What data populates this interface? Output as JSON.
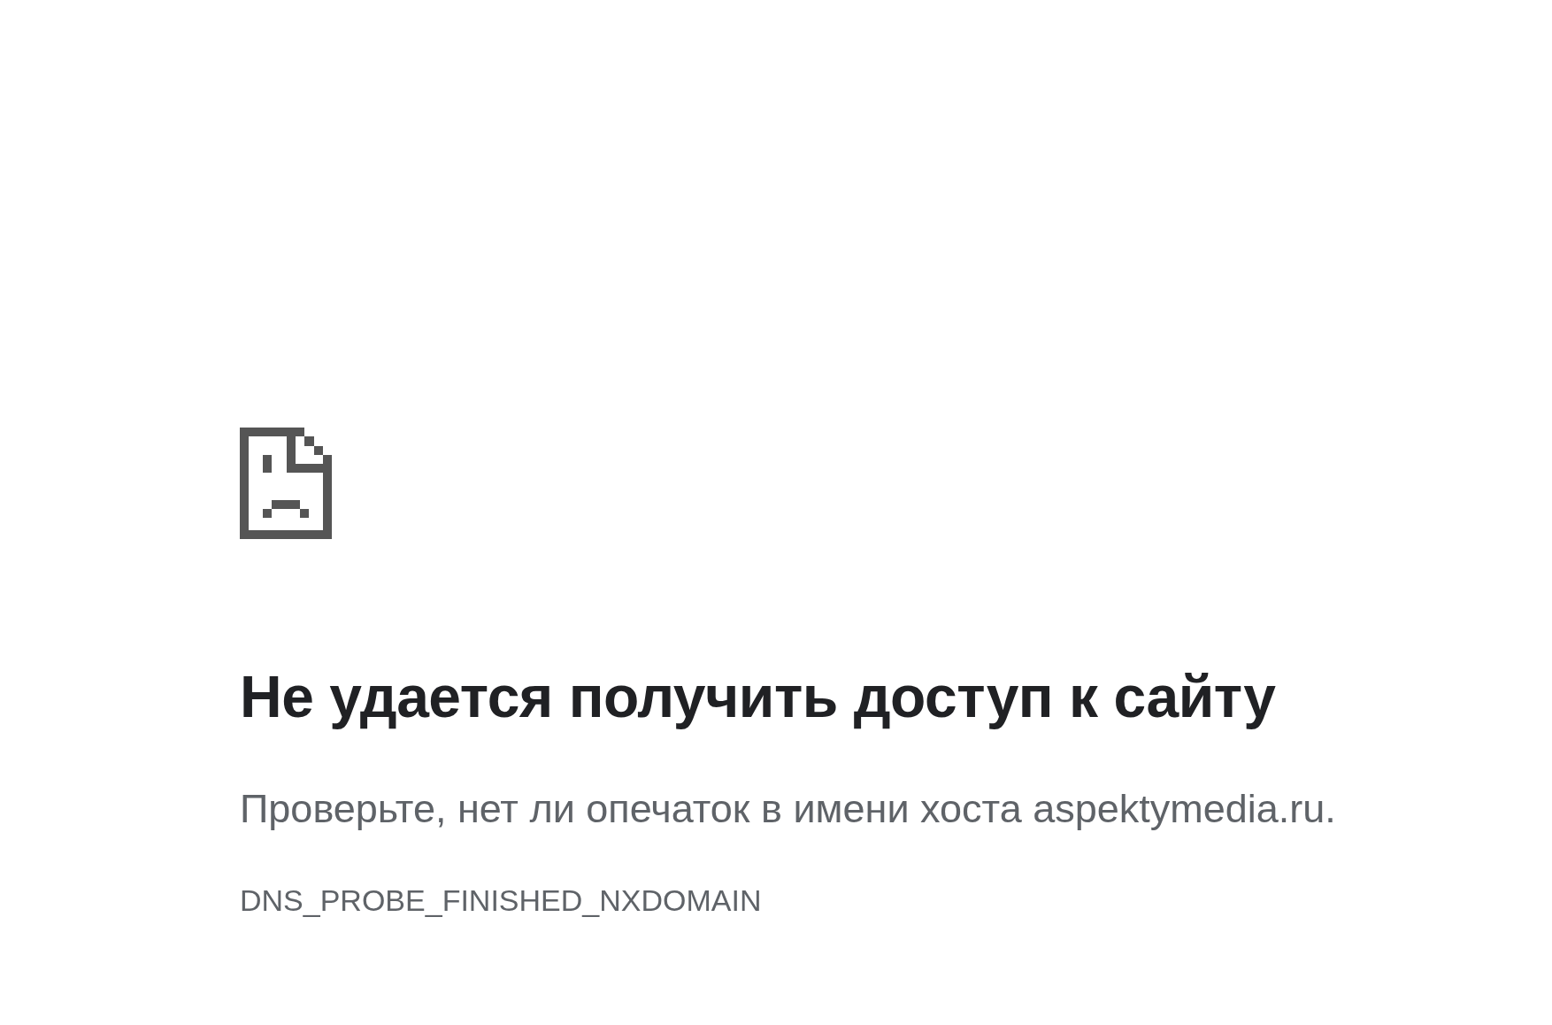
{
  "error": {
    "heading": "Не удается получить доступ к сайту",
    "message": "Проверьте, нет ли опечаток в имени хоста aspektymedia.ru.",
    "code": "DNS_PROBE_FINISHED_NXDOMAIN"
  }
}
